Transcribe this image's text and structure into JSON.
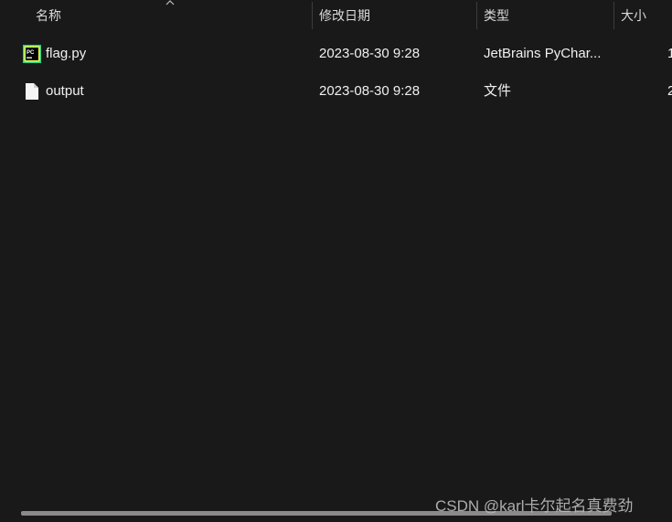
{
  "columns": {
    "name": "名称",
    "modified": "修改日期",
    "type": "类型",
    "size": "大小"
  },
  "files": [
    {
      "name": "flag.py",
      "modified": "2023-08-30 9:28",
      "type": "JetBrains PyChar...",
      "size_partial": "1",
      "icon": "pycharm-file-icon"
    },
    {
      "name": "output",
      "modified": "2023-08-30 9:28",
      "type": "文件",
      "size_partial": "2",
      "icon": "generic-file-icon"
    }
  ],
  "watermark": "CSDN @karl卡尔起名真费劲",
  "colors": {
    "background": "#191919",
    "pycharm_green": "#21d789",
    "pycharm_yellow": "#fcf84a"
  }
}
